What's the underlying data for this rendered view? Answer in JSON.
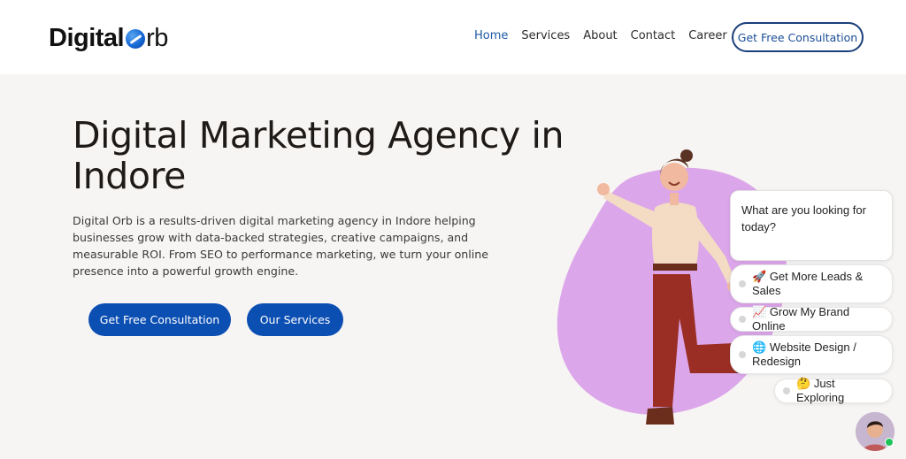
{
  "brand": {
    "logo_part1": "Digital",
    "logo_part2": "rb",
    "logo_orb_icon": "orb-icon"
  },
  "nav": {
    "items": [
      {
        "label": "Home",
        "active": true
      },
      {
        "label": "Services",
        "active": false
      },
      {
        "label": "About",
        "active": false
      },
      {
        "label": "Contact",
        "active": false
      },
      {
        "label": "Career",
        "active": false,
        "has_dropdown": true
      }
    ],
    "career_caret": "⌄",
    "cta_label": "Get Free Consultation"
  },
  "hero": {
    "title": "Digital Marketing Agency in Indore",
    "description": "Digital Orb is a results-driven digital marketing agency in Indore helping businesses grow with data-backed strategies, creative campaigns, and measurable ROI. From SEO to performance marketing, we turn your online presence into a powerful growth engine.",
    "primary_button": "Get Free Consultation",
    "secondary_button": "Our Services"
  },
  "chat": {
    "question": "What are you looking for today?",
    "options": [
      {
        "emoji": "🚀",
        "label": "Get More Leads & Sales"
      },
      {
        "emoji": "📈",
        "label": "Grow My Brand Online"
      },
      {
        "emoji": "🌐",
        "label": "Website Design / Redesign"
      },
      {
        "emoji": "🤔",
        "label": "Just Exploring"
      }
    ],
    "status": "online"
  },
  "colors": {
    "brand_blue": "#0c4fb3",
    "nav_active": "#1f5aa6",
    "blob": "#dca6ea",
    "background": "#f7f5f3",
    "online": "#1ec45a"
  }
}
